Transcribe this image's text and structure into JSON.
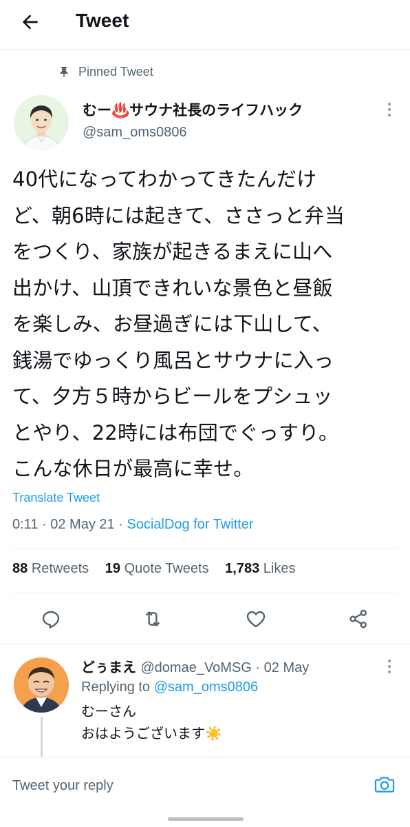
{
  "header": {
    "title": "Tweet",
    "back_icon": "back-arrow-icon"
  },
  "pinned": {
    "label": "Pinned Tweet",
    "icon": "pin-icon"
  },
  "tweet": {
    "author_name": "むー♨️サウナ社長のライフハック",
    "author_handle": "@sam_oms0806",
    "text": "40代になってわかってきたんだけ\nど、朝6時には起きて、ささっと弁当\nをつくり、家族が起きるまえに山へ\n出かけ、山頂できれいな景色と昼飯\nを楽しみ、お昼過ぎには下山して、\n銭湯でゆっくり風呂とサウナに入っ\nて、夕方５時からビールをプシュッ\nとやり、22時には布団でぐっすり。\nこんな休日が最高に幸せ。",
    "translate_label": "Translate Tweet",
    "time": "0:11",
    "date": "02 May 21",
    "source": "SocialDog for Twitter",
    "separator": " · "
  },
  "stats": {
    "retweets_count": "88",
    "retweets_label": "Retweets",
    "quotes_count": "19",
    "quotes_label": "Quote Tweets",
    "likes_count": "1,783",
    "likes_label": "Likes"
  },
  "actions": [
    "reply-icon",
    "retweet-icon",
    "like-icon",
    "share-icon"
  ],
  "reply": {
    "name": "どぅまえ",
    "handle": "@domae_VoMSG",
    "date": "02 May",
    "separator": " · ",
    "replying_prefix": "Replying to",
    "replying_to": "@sam_oms0806",
    "text": "むーさん\nおはようございます☀️"
  },
  "composer": {
    "placeholder": "Tweet your reply",
    "camera_icon": "camera-icon"
  },
  "colors": {
    "accent": "#1d9bf0",
    "secondary_text": "#536471",
    "border": "#e6ecf0",
    "text": "#0f1419"
  }
}
